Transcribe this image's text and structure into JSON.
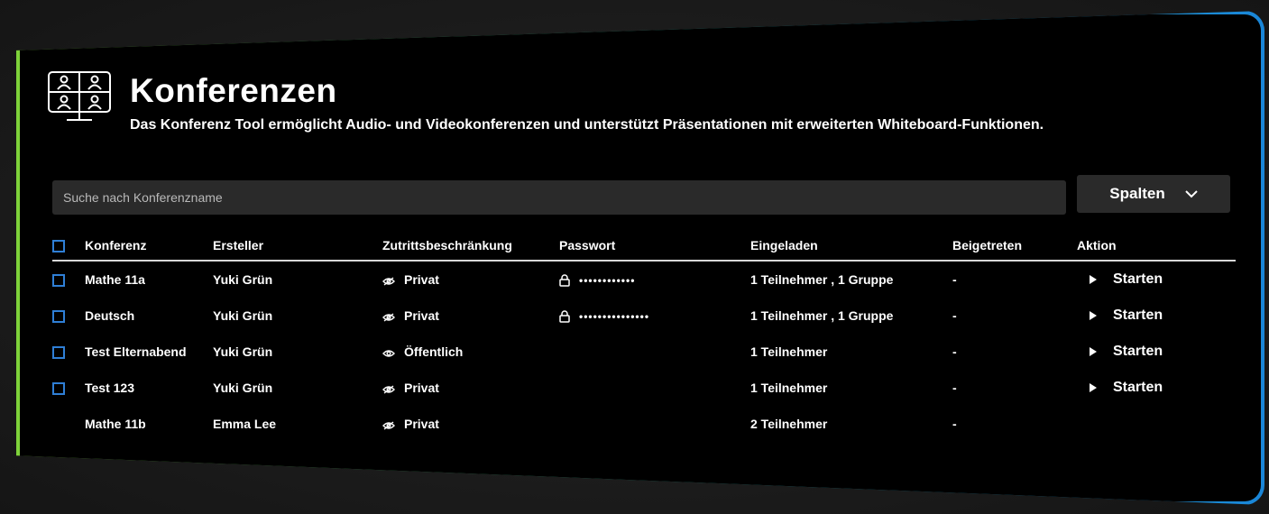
{
  "header": {
    "title": "Konferenzen",
    "subtitle": "Das Konferenz Tool ermöglicht Audio- und Videokonferenzen und unterstützt Präsentationen mit erweiterten Whiteboard-Funktionen.",
    "icon": "video-conference-icon"
  },
  "search": {
    "placeholder": "Suche nach Konferenzname"
  },
  "columns_button": {
    "label": "Spalten",
    "icon": "chevron-down-icon"
  },
  "table": {
    "headers": {
      "conference": "Konferenz",
      "creator": "Ersteller",
      "access": "Zutrittsbeschränkung",
      "password": "Passwort",
      "invited": "Eingeladen",
      "joined": "Beigetreten",
      "action": "Aktion"
    },
    "rows": [
      {
        "name": "Mathe 11a",
        "creator": "Yuki Grün",
        "access": "Privat",
        "access_icon": "eye-slash-icon",
        "password": "••••••••••••",
        "invited": "1 Teilnehmer , 1 Gruppe",
        "joined": "-",
        "action": "Starten"
      },
      {
        "name": "Deutsch",
        "creator": "Yuki Grün",
        "access": "Privat",
        "access_icon": "eye-slash-icon",
        "password": "•••••••••••••••",
        "invited": "1 Teilnehmer , 1 Gruppe",
        "joined": "-",
        "action": "Starten"
      },
      {
        "name": "Test Elternabend",
        "creator": "Yuki Grün",
        "access": "Öffentlich",
        "access_icon": "eye-icon",
        "password": "",
        "invited": "1 Teilnehmer",
        "joined": "-",
        "action": "Starten"
      },
      {
        "name": "Test 123",
        "creator": "Yuki Grün",
        "access": "Privat",
        "access_icon": "eye-slash-icon",
        "password": "",
        "invited": "1 Teilnehmer",
        "joined": "-",
        "action": "Starten"
      },
      {
        "name": "Mathe 11b",
        "creator": "Emma Lee",
        "access": "Privat",
        "access_icon": "eye-slash-icon",
        "password": "",
        "invited": "2 Teilnehmer",
        "joined": "-",
        "action": ""
      }
    ]
  },
  "colors": {
    "panel_bg": "#000000",
    "accent_blue": "#2f7fd6",
    "border_gradient_start": "#7ed23a",
    "border_gradient_end": "#1a86d8",
    "input_bg": "#2a2a2a"
  }
}
